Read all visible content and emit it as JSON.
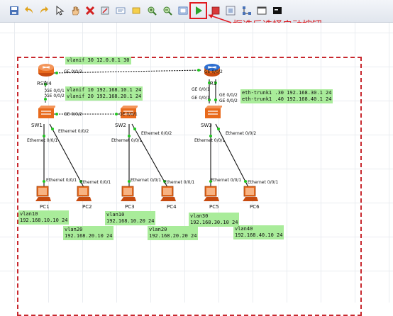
{
  "toolbar": {
    "icons": [
      "save-icon",
      "undo-icon",
      "redo-icon",
      "select-icon",
      "hand-icon",
      "delete-icon",
      "clear-icon",
      "text-icon",
      "rect-icon",
      "zoom-in-icon",
      "zoom-out-icon",
      "fit-icon",
      "start-icon",
      "stop-icon",
      "capture-icon",
      "topology-icon",
      "window-icon",
      "terminal-icon"
    ]
  },
  "annotation": "框选后选择启动按钮",
  "devices": {
    "rsw4": "RSW4",
    "r1": "R1",
    "sw1": "SW1",
    "sw2": "SW2",
    "sw3": "SW3",
    "pc1": "PC1",
    "pc2": "PC2",
    "pc3": "PC3",
    "pc4": "PC4",
    "pc5": "PC5",
    "pc6": "PC6"
  },
  "ports": {
    "rsw4_ge003": "GE 0/0/3",
    "r1_ge002_top": "GE 0/0/2",
    "rsw4_ge001": "GE 0/0/1",
    "rsw4_ge002": "GE 0/0/2",
    "sw1_ge002": "GE 0/0/2",
    "sw2_ge001": "GE 0/0/1",
    "r1_ge001_a": "GE 0/0/1",
    "r1_ge001_b": "GE 0/0/1",
    "sw3_ge002_a": "GE 0/0/2",
    "sw3_ge002_b": "GE 0/0/2",
    "sw1_eth002": "Ethernet 0/0/2",
    "sw1_eth001": "Ethernet 0/0/1",
    "sw2_eth002": "Ethernet 0/0/2",
    "sw2_eth001": "Ethernet 0/0/1",
    "sw3_eth002": "Ethernet 0/0/2",
    "sw3_eth001": "Ethernet 0/0/1",
    "pc1_eth": "Ethernet 0/0/1",
    "pc2_eth": "Ethernet 0/0/1",
    "pc3_eth": "Ethernet 0/0/1",
    "pc4_eth": "Ethernet 0/0/1",
    "pc5_eth": "Ethernet 0/0/1",
    "pc6_eth": "Ethernet 0/0/1"
  },
  "notes": {
    "vlanif30": "vlanif 30 12.0.0.1 30",
    "vlanif_rsw4": "vlanif 10 192.168.10.1 24\nvlanif 20 192.168.20.1 24",
    "eth_trunk": "eth-trunk1 .30 192.168.30.1 24\neth-trunk1 .40 192.168.40.1 24",
    "pc1": "vlan10\n192.168.10.10 24",
    "pc2": "vlan20\n192.168.20.10 24",
    "pc3": "vlan10\n192.168.10.20 24",
    "pc4": "vlan20\n192.168.20.20 24",
    "pc5": "vlan30\n192.168.30.10 24",
    "pc6": "vlan40\n192.168.40.10 24"
  },
  "colors": {
    "accent_red": "#e11b22",
    "note_green": "#a9ec9a",
    "router_blue": "#2f6fd0",
    "device_orange": "#e86a1c"
  }
}
